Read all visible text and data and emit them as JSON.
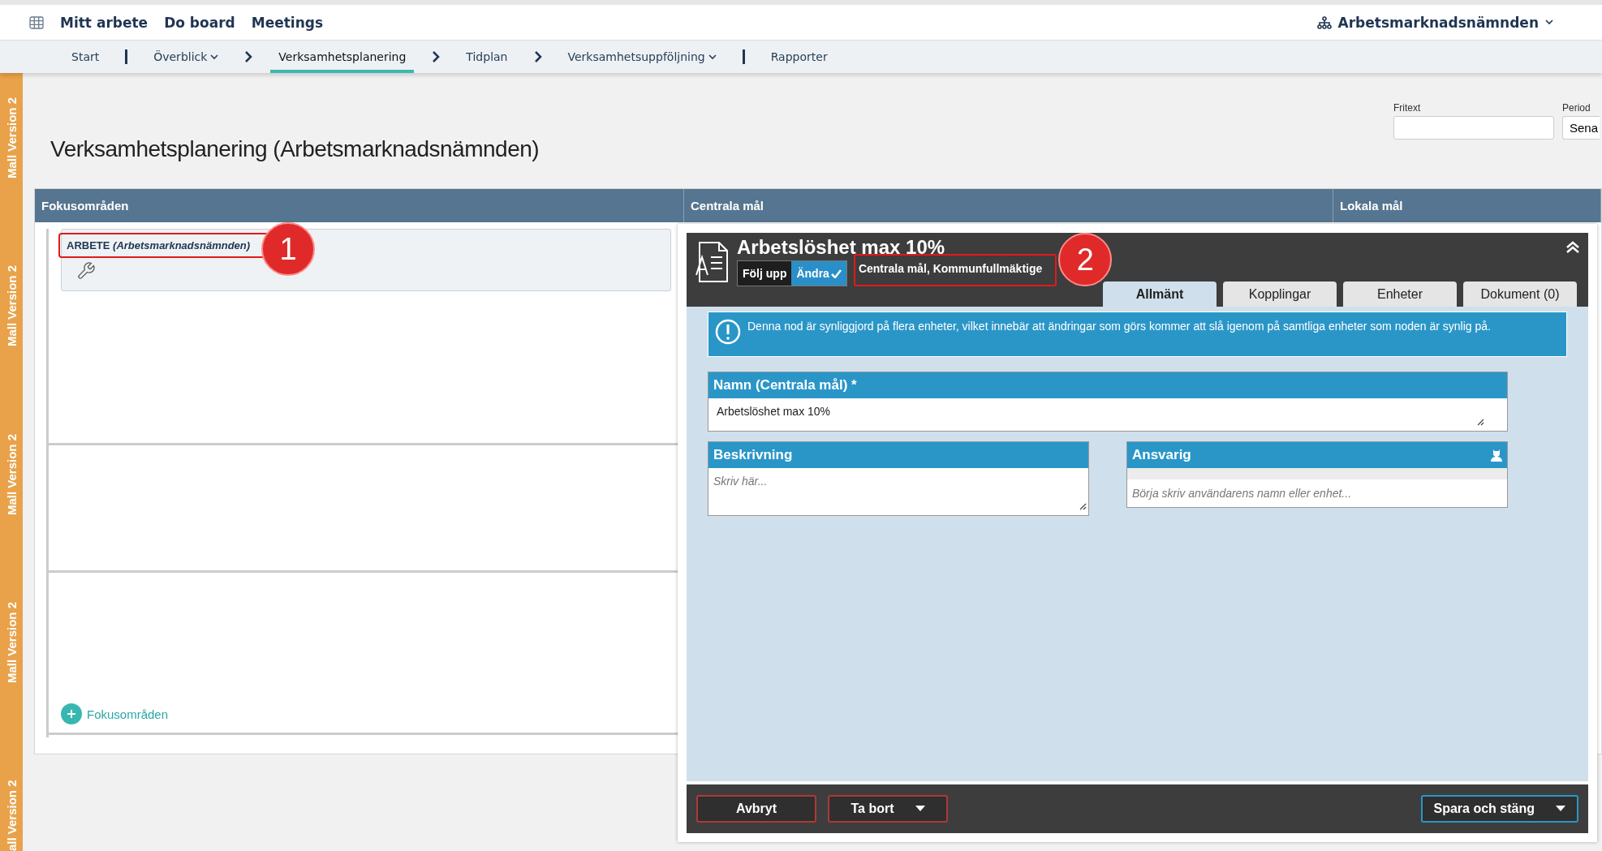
{
  "top_nav": {
    "items": [
      "Mitt arbete",
      "Do board",
      "Meetings"
    ],
    "organization": "Arbetsmarknadsnämnden"
  },
  "sub_nav": [
    {
      "label": "Start",
      "selected": false,
      "dropdown": false,
      "bar_after": true
    },
    {
      "label": "Överblick",
      "selected": false,
      "dropdown": true,
      "chevron_after": true
    },
    {
      "label": "Verksamhetsplanering",
      "selected": true,
      "dropdown": false,
      "chevron_after": true
    },
    {
      "label": "Tidplan",
      "selected": false,
      "dropdown": false,
      "chevron_after": true
    },
    {
      "label": "Verksamhetsuppföljning",
      "selected": false,
      "dropdown": true,
      "bar_after": true
    },
    {
      "label": "Rapporter",
      "selected": false,
      "dropdown": false
    }
  ],
  "side_stripe": [
    "Mall Version 2",
    "Mall Version 2",
    "Mall Version 2",
    "Mall Version 2",
    "all Version 2"
  ],
  "page_title": "Verksamhetsplanering (Arbetsmarknadsnämnden)",
  "filters": [
    {
      "label": "Fritext"
    },
    {
      "label": "Period",
      "value": "Sena"
    }
  ],
  "board": {
    "columns": [
      "Fokusområden",
      "Centrala mål",
      "Lokala mål"
    ],
    "cards": [
      {
        "title": "ARBETE",
        "unit": "(Arbetsmarknadsnämnden)",
        "marker": "1"
      }
    ],
    "add_button": "Fokusområden"
  },
  "detail": {
    "title": "Arbetslöshet max 10%",
    "modes": [
      {
        "label": "Följ upp",
        "selected": false
      },
      {
        "label": "Ändra",
        "selected": true
      }
    ],
    "path": "Centrala mål, Kommunfullmäktige",
    "marker": "2",
    "tabs": [
      {
        "label": "Allmänt",
        "selected": true
      },
      {
        "label": "Kopplingar",
        "selected": false
      },
      {
        "label": "Enheter",
        "selected": false
      },
      {
        "label": "Dokument (0)",
        "selected": false
      }
    ],
    "notice": "Denna nod är synliggjord på flera enheter, vilket innebär att ändringar som görs kommer att slå igenom på samtliga enheter som noden är synlig på.",
    "fields": [
      {
        "kind": "text",
        "wide": true,
        "label": "Namn (Centrala mål) *",
        "value": "Arbetslöshet max 10%"
      },
      {
        "kind": "text",
        "wide": false,
        "label": "Beskrivning",
        "placeholder": "Skriv här..."
      },
      {
        "kind": "user",
        "wide": false,
        "label": "Ansvarig",
        "placeholder": "Börja skriv användarens namn eller enhet..."
      }
    ],
    "footer": {
      "left": [
        {
          "label": "Avbryt",
          "dropdown": false
        },
        {
          "label": "Ta bort",
          "dropdown": true
        }
      ],
      "right": [
        {
          "label": "Spara och stäng",
          "dropdown": true
        }
      ]
    }
  }
}
